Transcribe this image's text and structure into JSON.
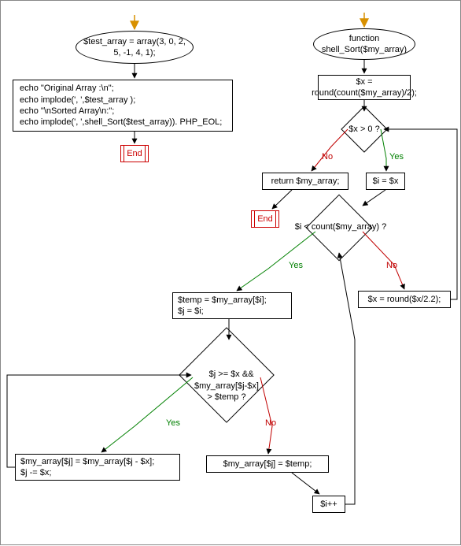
{
  "left": {
    "start": "$test_array = array(3, 0, 2, 5, -1, 4, 1);",
    "echo_block": "echo \"Original Array :\\n\";\necho implode(', ',$test_array );\necho \"\\nSorted Array\\n:\";\necho implode(', ',shell_Sort($test_array)). PHP_EOL;",
    "end": "End"
  },
  "right": {
    "func": "function\nshell_Sort($my_array)",
    "init_x": "$x = round(count($my_array)/2);",
    "cond_x": "$x > 0 ?",
    "ret": "return $my_array;",
    "end": "End",
    "init_i": "$i = $x",
    "cond_i": "$i < count($my_array) ?",
    "update_x": "$x = round($x/2.2);",
    "temp": "$temp = $my_array[$i];\n$j = $i;",
    "cond_j": "$j >= $x &&\n$my_array[$j-$x]\n> $temp ?",
    "swap": "$my_array[$j] = $my_array[$j - $x];\n$j -= $x;",
    "assign_temp": "$my_array[$j] = $temp;",
    "inc_i": "$i++",
    "yes": "Yes",
    "no": "No"
  },
  "chart_data": {
    "type": "flowchart",
    "nodes": [
      {
        "id": "L1",
        "type": "start",
        "text": "$test_array = array(3, 0, 2, 5, -1, 4, 1);"
      },
      {
        "id": "L2",
        "type": "process",
        "text": "echo \"Original Array :\\n\"; echo implode(', ',$test_array ); echo \"\\nSorted Array\\n:\"; echo implode(', ',shell_Sort($test_array)). PHP_EOL;"
      },
      {
        "id": "L3",
        "type": "end",
        "text": "End"
      },
      {
        "id": "R1",
        "type": "start",
        "text": "function shell_Sort($my_array)"
      },
      {
        "id": "R2",
        "type": "process",
        "text": "$x = round(count($my_array)/2);"
      },
      {
        "id": "R3",
        "type": "decision",
        "text": "$x > 0 ?"
      },
      {
        "id": "R4",
        "type": "process",
        "text": "return $my_array;"
      },
      {
        "id": "R5",
        "type": "end",
        "text": "End"
      },
      {
        "id": "R6",
        "type": "process",
        "text": "$i = $x"
      },
      {
        "id": "R7",
        "type": "decision",
        "text": "$i < count($my_array) ?"
      },
      {
        "id": "R8",
        "type": "process",
        "text": "$x = round($x/2.2);"
      },
      {
        "id": "R9",
        "type": "process",
        "text": "$temp = $my_array[$i]; $j = $i;"
      },
      {
        "id": "R10",
        "type": "decision",
        "text": "$j >= $x && $my_array[$j-$x] > $temp ?"
      },
      {
        "id": "R11",
        "type": "process",
        "text": "$my_array[$j] = $my_array[$j - $x]; $j -= $x;"
      },
      {
        "id": "R12",
        "type": "process",
        "text": "$my_array[$j] = $temp;"
      },
      {
        "id": "R13",
        "type": "process",
        "text": "$i++"
      }
    ],
    "edges": [
      {
        "from": "L1",
        "to": "L2"
      },
      {
        "from": "L2",
        "to": "L3"
      },
      {
        "from": "R1",
        "to": "R2"
      },
      {
        "from": "R2",
        "to": "R3"
      },
      {
        "from": "R3",
        "to": "R4",
        "label": "No"
      },
      {
        "from": "R3",
        "to": "R6",
        "label": "Yes"
      },
      {
        "from": "R4",
        "to": "R5"
      },
      {
        "from": "R6",
        "to": "R7"
      },
      {
        "from": "R7",
        "to": "R9",
        "label": "Yes"
      },
      {
        "from": "R7",
        "to": "R8",
        "label": "No"
      },
      {
        "from": "R8",
        "to": "R3"
      },
      {
        "from": "R9",
        "to": "R10"
      },
      {
        "from": "R10",
        "to": "R11",
        "label": "Yes"
      },
      {
        "from": "R10",
        "to": "R12",
        "label": "No"
      },
      {
        "from": "R11",
        "to": "R10"
      },
      {
        "from": "R12",
        "to": "R13"
      },
      {
        "from": "R13",
        "to": "R7"
      }
    ]
  }
}
